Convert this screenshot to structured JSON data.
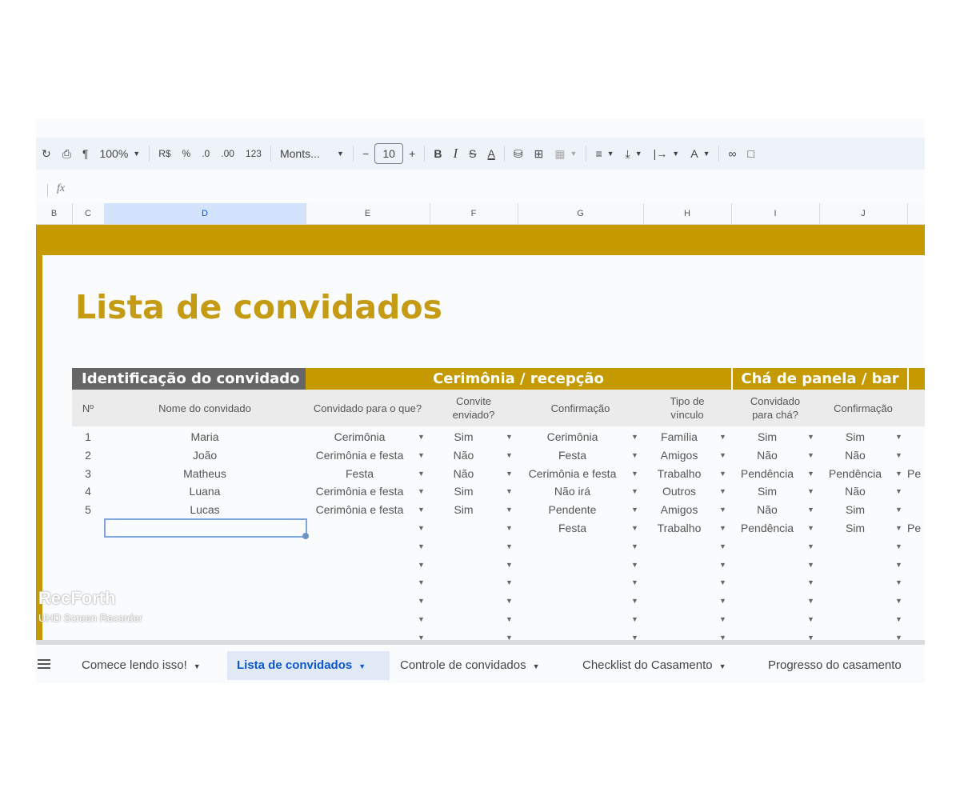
{
  "toolbar": {
    "zoom": "100%",
    "currency": "R$",
    "percent": "%",
    "decrease_decimals": ".0",
    "increase_decimals": ".00",
    "number_format": "123",
    "font": "Monts...",
    "font_size": "10",
    "minus": "−",
    "plus": "+",
    "bold": "B",
    "italic": "I",
    "strike": "S",
    "text_color": "A"
  },
  "formula_bar": {
    "fx": "fx"
  },
  "columns": [
    "B",
    "C",
    "D",
    "E",
    "F",
    "G",
    "H",
    "I",
    "J"
  ],
  "sheet": {
    "title": "Lista de convidados",
    "groups": {
      "identificacao": "Identificação do convidado",
      "cerimonia": "Cerimônia / recepção",
      "cha": "Chá de panela / bar"
    },
    "headers": {
      "num": "Nº",
      "nome": "Nome do convidado",
      "convidado_para": "Convidado para o que?",
      "convite_enviado": "Convite enviado?",
      "confirmacao": "Confirmação",
      "tipo_vinculo": "Tipo de vínculo",
      "convidado_cha": "Convidado para chá?",
      "confirmacao_cha": "Confirmação"
    },
    "rows": [
      {
        "num": "1",
        "nome": "Maria",
        "para": "Cerimônia",
        "enviado": "Sim",
        "confirmacao": "Cerimônia",
        "tipo": "Família",
        "cha": "Sim",
        "conf_cha": "Sim",
        "extra": ""
      },
      {
        "num": "2",
        "nome": "João",
        "para": "Cerimônia e festa",
        "enviado": "Não",
        "confirmacao": "Festa",
        "tipo": "Amigos",
        "cha": "Não",
        "conf_cha": "Não",
        "extra": ""
      },
      {
        "num": "3",
        "nome": "Matheus",
        "para": "Festa",
        "enviado": "Não",
        "confirmacao": "Cerimônia e festa",
        "tipo": "Trabalho",
        "cha": "Pendência",
        "conf_cha": "Pendência",
        "extra": "Pe"
      },
      {
        "num": "4",
        "nome": "Luana",
        "para": "Cerimônia e festa",
        "enviado": "Sim",
        "confirmacao": "Não irá",
        "tipo": "Outros",
        "cha": "Sim",
        "conf_cha": "Não",
        "extra": ""
      },
      {
        "num": "5",
        "nome": "Lucas",
        "para": "Cerimônia e festa",
        "enviado": "Sim",
        "confirmacao": "Pendente",
        "tipo": "Amigos",
        "cha": "Não",
        "conf_cha": "Sim",
        "extra": ""
      },
      {
        "num": "",
        "nome": "",
        "para": "",
        "enviado": "",
        "confirmacao": "Festa",
        "tipo": "Trabalho",
        "cha": "Pendência",
        "conf_cha": "Sim",
        "extra": "Pe"
      }
    ]
  },
  "tabs": [
    {
      "label": "Comece lendo isso!",
      "active": false
    },
    {
      "label": "Lista de convidados",
      "active": true
    },
    {
      "label": "Controle de convidados",
      "active": false
    },
    {
      "label": "Checklist do Casamento",
      "active": false
    },
    {
      "label": "Progresso do casamento",
      "active": false
    }
  ],
  "watermark": {
    "line1": "RecForth",
    "line2": "UHD Screen Recorder"
  },
  "colors": {
    "accent_gold": "#c59a00",
    "title_gold": "#c49b12",
    "group_gray": "#666666",
    "selection_blue": "#0b57d0"
  }
}
